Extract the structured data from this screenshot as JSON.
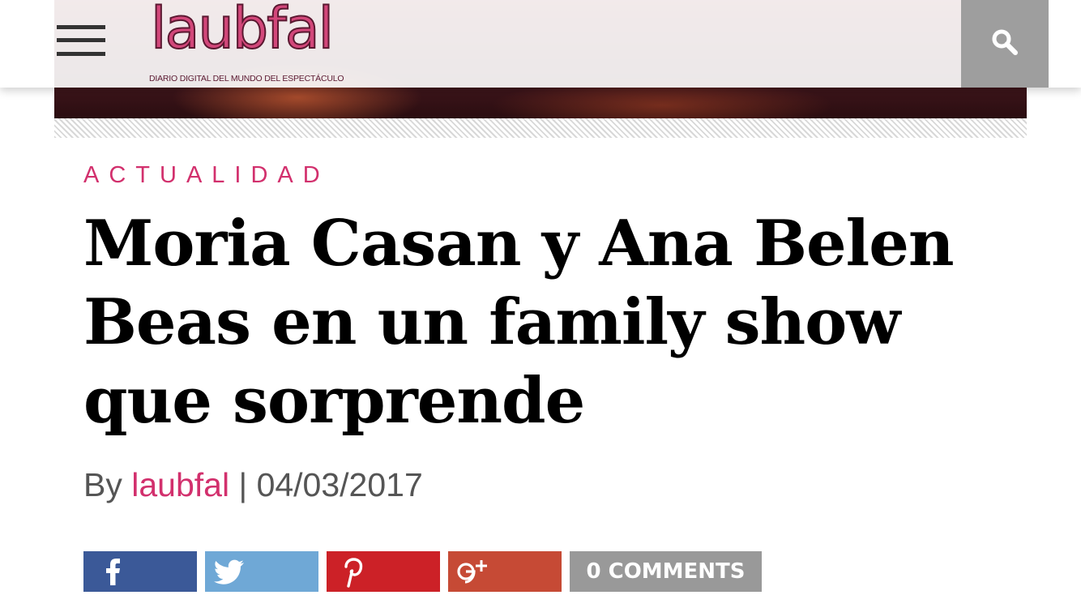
{
  "header": {
    "logo_text": "laubfal",
    "logo_tagline": "DIARIO DIGITAL DEL MUNDO DEL ESPECTÁCULO",
    "menu_icon": "hamburger-menu-icon",
    "search_icon": "search-icon"
  },
  "article": {
    "category": "ACTUALIDAD",
    "title": "Moria Casan y Ana Belen Beas en un family show que sorprende",
    "byline_prefix": "By",
    "author": "laubfal",
    "separator": "|",
    "date": "04/03/2017"
  },
  "share": {
    "facebook_icon": "facebook-icon",
    "twitter_icon": "twitter-icon",
    "pinterest_icon": "pinterest-icon",
    "googleplus_icon": "google-plus-icon",
    "comments_label": "0 COMMENTS"
  },
  "colors": {
    "accent": "#d2306d",
    "facebook": "#3b5998",
    "twitter": "#6fa8d6",
    "pinterest": "#cc2127",
    "googleplus": "#c64a35",
    "comments": "#999999"
  }
}
